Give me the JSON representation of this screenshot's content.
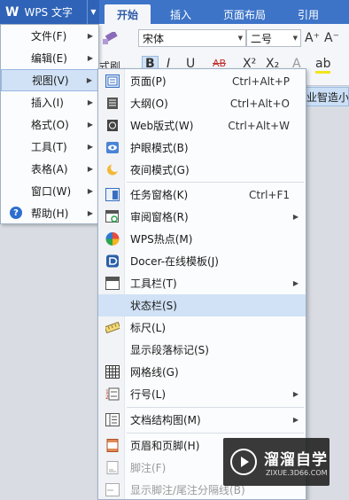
{
  "app": {
    "logo": "W",
    "title": "WPS 文字"
  },
  "tabs": [
    "开始",
    "插入",
    "页面布局",
    "引用"
  ],
  "ribbon": {
    "font_name": "宋体",
    "font_size": "二号",
    "grow_font": "A⁺",
    "shrink_font": "A⁻",
    "format_painter_partial": "式刷",
    "bold": "B",
    "italic": "I",
    "underline": "U",
    "strike": "AB",
    "superscript": "X²",
    "subscript": "X₂",
    "partial_button": "业智造小"
  },
  "main_menu": {
    "items": [
      {
        "label": "文件(F)",
        "has_sub": true
      },
      {
        "label": "编辑(E)",
        "has_sub": true
      },
      {
        "label": "视图(V)",
        "has_sub": true,
        "selected": true
      },
      {
        "label": "插入(I)",
        "has_sub": true
      },
      {
        "label": "格式(O)",
        "has_sub": true
      },
      {
        "label": "工具(T)",
        "has_sub": true
      },
      {
        "label": "表格(A)",
        "has_sub": true
      },
      {
        "label": "窗口(W)",
        "has_sub": true
      },
      {
        "label": "帮助(H)",
        "has_sub": true
      }
    ]
  },
  "view_menu": {
    "items": [
      {
        "label": "页面(P)",
        "shortcut": "Ctrl+Alt+P",
        "icon": "page-view-icon"
      },
      {
        "label": "大纲(O)",
        "shortcut": "Ctrl+Alt+O",
        "icon": "outline-icon"
      },
      {
        "label": "Web版式(W)",
        "shortcut": "Ctrl+Alt+W",
        "icon": "web-layout-icon"
      },
      {
        "label": "护眼模式(B)",
        "shortcut": "",
        "icon": "eye-protect-icon"
      },
      {
        "label": "夜间模式(G)",
        "shortcut": "",
        "icon": "night-mode-icon"
      },
      {
        "label": "任务窗格(K)",
        "shortcut": "Ctrl+F1",
        "icon": "task-pane-icon"
      },
      {
        "label": "审阅窗格(R)",
        "shortcut": "",
        "icon": "review-pane-icon",
        "has_sub": true
      },
      {
        "label": "WPS热点(M)",
        "shortcut": "",
        "icon": "wps-hotspot-icon"
      },
      {
        "label": "Docer-在线模板(J)",
        "shortcut": "",
        "icon": "docer-icon"
      },
      {
        "label": "工具栏(T)",
        "shortcut": "",
        "icon": "toolbar-icon",
        "has_sub": true
      },
      {
        "label": "状态栏(S)",
        "shortcut": "",
        "icon": "",
        "highlighted": true
      },
      {
        "label": "标尺(L)",
        "shortcut": "",
        "icon": "ruler-icon"
      },
      {
        "label": "显示段落标记(S)",
        "shortcut": "",
        "icon": ""
      },
      {
        "label": "网格线(G)",
        "shortcut": "",
        "icon": "gridlines-icon"
      },
      {
        "label": "行号(L)",
        "shortcut": "",
        "icon": "line-number-icon",
        "has_sub": true
      },
      {
        "label": "文档结构图(M)",
        "shortcut": "",
        "icon": "doc-map-icon",
        "has_sub": true
      },
      {
        "label": "页眉和页脚(H)",
        "shortcut": "",
        "icon": "header-footer-icon"
      },
      {
        "label": "脚注(F)",
        "shortcut": "",
        "icon": "footnote-icon",
        "disabled": true
      },
      {
        "label": "显示脚注/尾注分隔线(B)",
        "shortcut": "",
        "icon": "footnote-separator-icon",
        "disabled": true
      }
    ]
  },
  "watermark": {
    "title": "溜溜自学",
    "url": "ZIXUE.3D66.COM"
  },
  "colors": {
    "title_bar": "#3d74c8",
    "menu_highlight": "#d1e2f6",
    "selected_border": "#98b8e0"
  }
}
